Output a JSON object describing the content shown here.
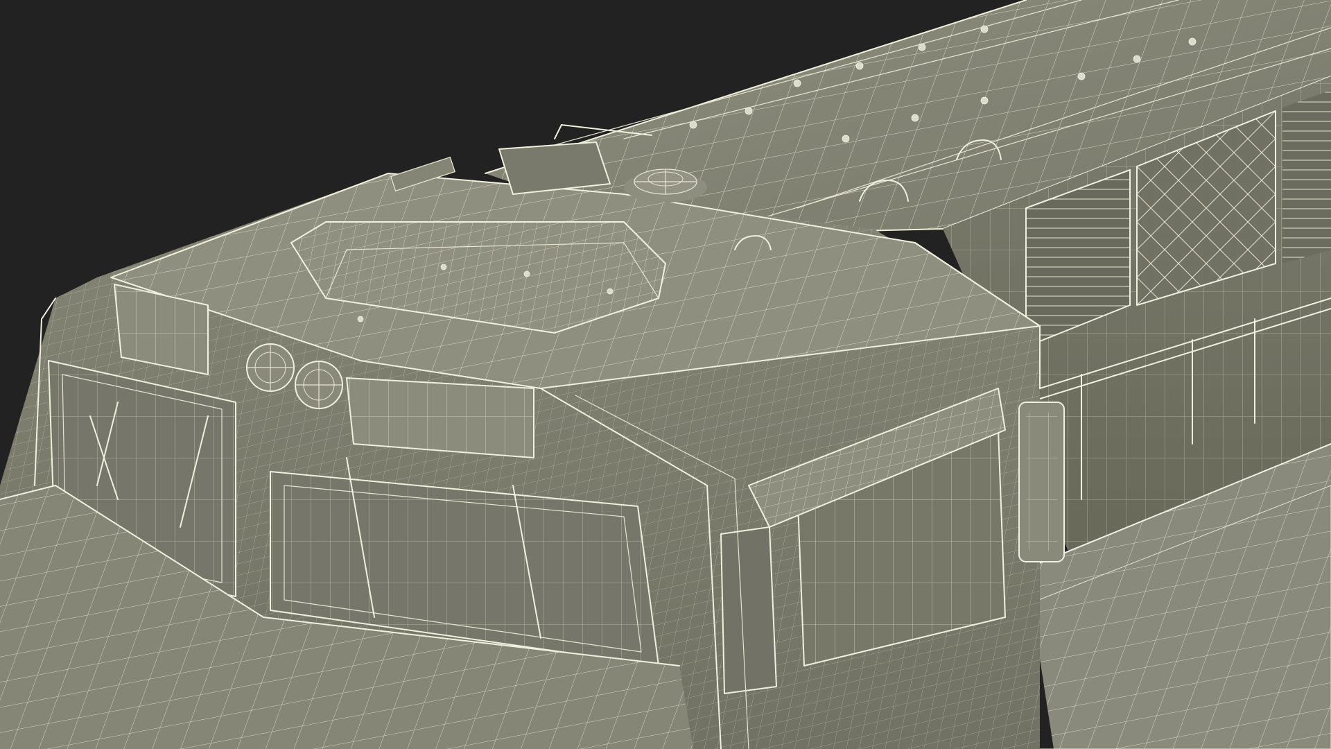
{
  "image": {
    "subject": "locomotive-wireframe-render",
    "colors": {
      "background": "#222222",
      "surface": "#8a8a7a",
      "surface_dark": "#6e6e62",
      "surface_light": "#9c9c8c",
      "wire": "#e6e6d2"
    }
  }
}
